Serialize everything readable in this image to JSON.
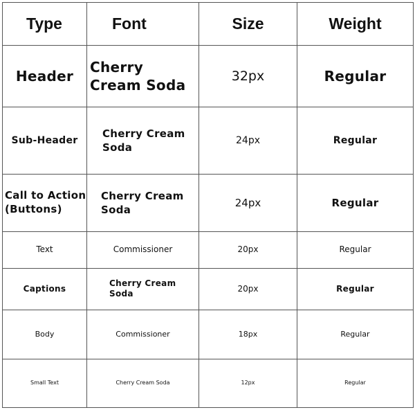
{
  "table": {
    "headers": {
      "type": "Type",
      "font": "Font",
      "size": "Size",
      "weight": "Weight"
    },
    "rows": [
      {
        "type": "Header",
        "font": "Cherry Cream Soda",
        "size": "32px",
        "weight": "Regular"
      },
      {
        "type": "Sub-Header",
        "font": "Cherry Cream Soda",
        "size": "24px",
        "weight": "Regular"
      },
      {
        "type": "Call to Action (Buttons)",
        "font": "Cherry Cream Soda",
        "size": "24px",
        "weight": "Regular"
      },
      {
        "type": "Text",
        "font": "Commissioner",
        "size": "20px",
        "weight": "Regular"
      },
      {
        "type": "Captions",
        "font": "Cherry Cream Soda",
        "size": "20px",
        "weight": "Regular"
      },
      {
        "type": "Body",
        "font": "Commissioner",
        "size": "18px",
        "weight": "Regular"
      },
      {
        "type": "Small Text",
        "font": "Cherry Cream Soda",
        "size": "12px",
        "weight": "Regular"
      }
    ]
  }
}
